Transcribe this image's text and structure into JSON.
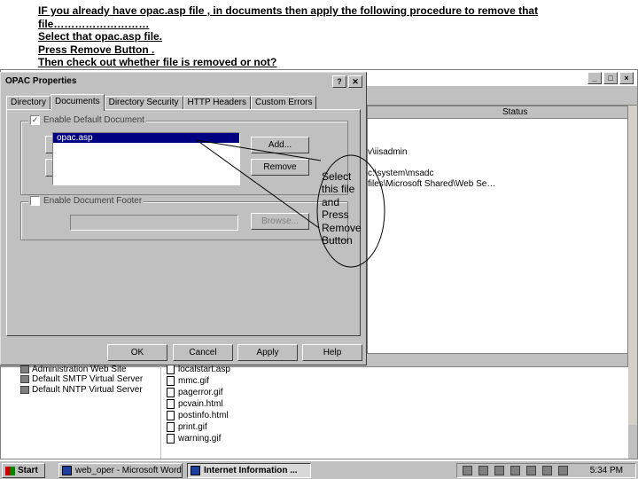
{
  "caption": {
    "lines": [
      "IF you already have opac.asp file , in documents then apply the following procedure to remove that",
      "file………………………",
      "Select that opac.asp file.",
      "Press Remove Button .",
      "Then check out whether file is removed or not?"
    ]
  },
  "background_window": {
    "list_header_status": "Status",
    "paths": [
      "v\\iisadmin",
      "c:\\system\\msadc",
      "files\\Microsoft Shared\\Web Se…"
    ],
    "tree_items": [
      "Administration Web Site",
      "Default SMTP Virtual Server",
      "Default NNTP Virtual Server"
    ],
    "files": [
      "localstart.asp",
      "mmc.gif",
      "pagerror.gif",
      "pcvain.html",
      "postinfo.html",
      "print.gif",
      "warning.gif"
    ]
  },
  "dialog": {
    "title": "OPAC Properties",
    "help_glyph": "?",
    "close_glyph": "✕",
    "tabs": [
      "Directory",
      "Documents",
      "Directory Security",
      "HTTP Headers",
      "Custom Errors"
    ],
    "active_tab": "Documents",
    "enable_default_document_label": "Enable Default Document",
    "enable_default_document_checked": "✓",
    "documents": [
      "opac.asp"
    ],
    "move_up_glyph": "↑",
    "move_down_glyph": "↓",
    "add_button": "Add...",
    "remove_button": "Remove",
    "enable_footer_label": "Enable Document Footer",
    "browse_button": "Browse...",
    "ok_button": "OK",
    "cancel_button": "Cancel",
    "apply_button": "Apply",
    "help_button": "Help"
  },
  "annotation": {
    "lines": [
      "Select",
      "this file",
      "and",
      "Press",
      "Remove",
      "Button"
    ]
  },
  "taskbar": {
    "start_label": "Start",
    "tasks": [
      "web_oper - Microsoft Word",
      "Internet Information ..."
    ],
    "clock": "5:34 PM"
  }
}
